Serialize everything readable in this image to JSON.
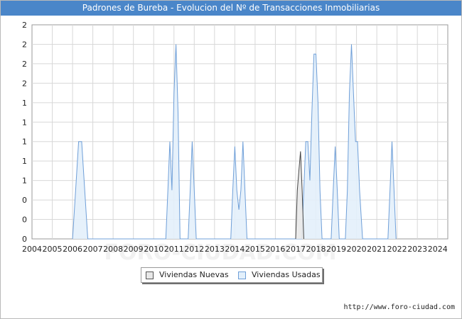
{
  "title": "Padrones de Bureba - Evolucion del Nº de Transacciones Inmobiliarias",
  "source": "http://www.foro-ciudad.com",
  "watermark": "FORO-CIUDAD.COM",
  "colors": {
    "title_bg": "#4a86c9",
    "nuevas_fill": "#e8e8e8",
    "nuevas_stroke": "#444444",
    "usadas_fill": "#e3f0fb",
    "usadas_stroke": "#6f9fd8",
    "grid": "#d8d8d8"
  },
  "chart_data": {
    "type": "area",
    "title": "Padrones de Bureba - Evolucion del Nº de Transacciones Inmobiliarias",
    "x_ticks": [
      "2004",
      "2005",
      "2006",
      "2007",
      "2008",
      "2009",
      "2010",
      "2011",
      "2012",
      "2013",
      "2014",
      "2015",
      "2016",
      "2017",
      "2018",
      "2019",
      "2020",
      "2021",
      "2022",
      "2023",
      "2024"
    ],
    "y_tick_labels": [
      "0",
      "0",
      "0",
      "1",
      "1",
      "1",
      "1",
      "1",
      "2",
      "2",
      "2",
      "2"
    ],
    "xlim": [
      2004,
      2024.5
    ],
    "ylim": [
      0,
      2.2
    ],
    "grid": true,
    "legend_position": "bottom",
    "series": [
      {
        "name": "Viviendas Nuevas",
        "color": "#444444",
        "points": [
          [
            2017.0,
            0
          ],
          [
            2017.08,
            0.5
          ],
          [
            2017.16,
            0.7
          ],
          [
            2017.24,
            0.9
          ],
          [
            2017.32,
            0.5
          ],
          [
            2017.4,
            0
          ]
        ]
      },
      {
        "name": "Viviendas Usadas",
        "color": "#6f9fd8",
        "points": [
          [
            2006.0,
            0
          ],
          [
            2006.15,
            0.5
          ],
          [
            2006.3,
            1.0
          ],
          [
            2006.45,
            1.0
          ],
          [
            2006.6,
            0.5
          ],
          [
            2006.75,
            0
          ],
          [
            2010.6,
            0
          ],
          [
            2010.7,
            0.5
          ],
          [
            2010.8,
            1.0
          ],
          [
            2010.9,
            0.5
          ],
          [
            2011.0,
            1.5
          ],
          [
            2011.1,
            2.0
          ],
          [
            2011.2,
            1.3
          ],
          [
            2011.3,
            0
          ],
          [
            2011.7,
            0
          ],
          [
            2011.8,
            0.5
          ],
          [
            2011.9,
            1.0
          ],
          [
            2012.0,
            0.5
          ],
          [
            2012.1,
            0
          ],
          [
            2013.8,
            0
          ],
          [
            2013.9,
            0.5
          ],
          [
            2014.0,
            0.95
          ],
          [
            2014.1,
            0.5
          ],
          [
            2014.2,
            0.3
          ],
          [
            2014.3,
            0.5
          ],
          [
            2014.4,
            1.0
          ],
          [
            2014.5,
            0.5
          ],
          [
            2014.6,
            0
          ],
          [
            2017.3,
            0
          ],
          [
            2017.4,
            0.5
          ],
          [
            2017.5,
            1.0
          ],
          [
            2017.6,
            1.0
          ],
          [
            2017.7,
            0.6
          ],
          [
            2017.8,
            1.3
          ],
          [
            2017.9,
            1.9
          ],
          [
            2018.0,
            1.9
          ],
          [
            2018.1,
            1.4
          ],
          [
            2018.2,
            0.5
          ],
          [
            2018.3,
            0
          ],
          [
            2018.75,
            0
          ],
          [
            2018.85,
            0.5
          ],
          [
            2018.95,
            0.95
          ],
          [
            2019.05,
            0.5
          ],
          [
            2019.15,
            0
          ],
          [
            2019.45,
            0
          ],
          [
            2019.55,
            0.5
          ],
          [
            2019.65,
            1.5
          ],
          [
            2019.75,
            2.0
          ],
          [
            2019.85,
            1.5
          ],
          [
            2019.95,
            1.0
          ],
          [
            2020.05,
            1.0
          ],
          [
            2020.15,
            0.5
          ],
          [
            2020.3,
            0
          ],
          [
            2021.55,
            0
          ],
          [
            2021.65,
            0.5
          ],
          [
            2021.75,
            1.0
          ],
          [
            2021.85,
            0.5
          ],
          [
            2021.95,
            0
          ]
        ]
      }
    ]
  }
}
